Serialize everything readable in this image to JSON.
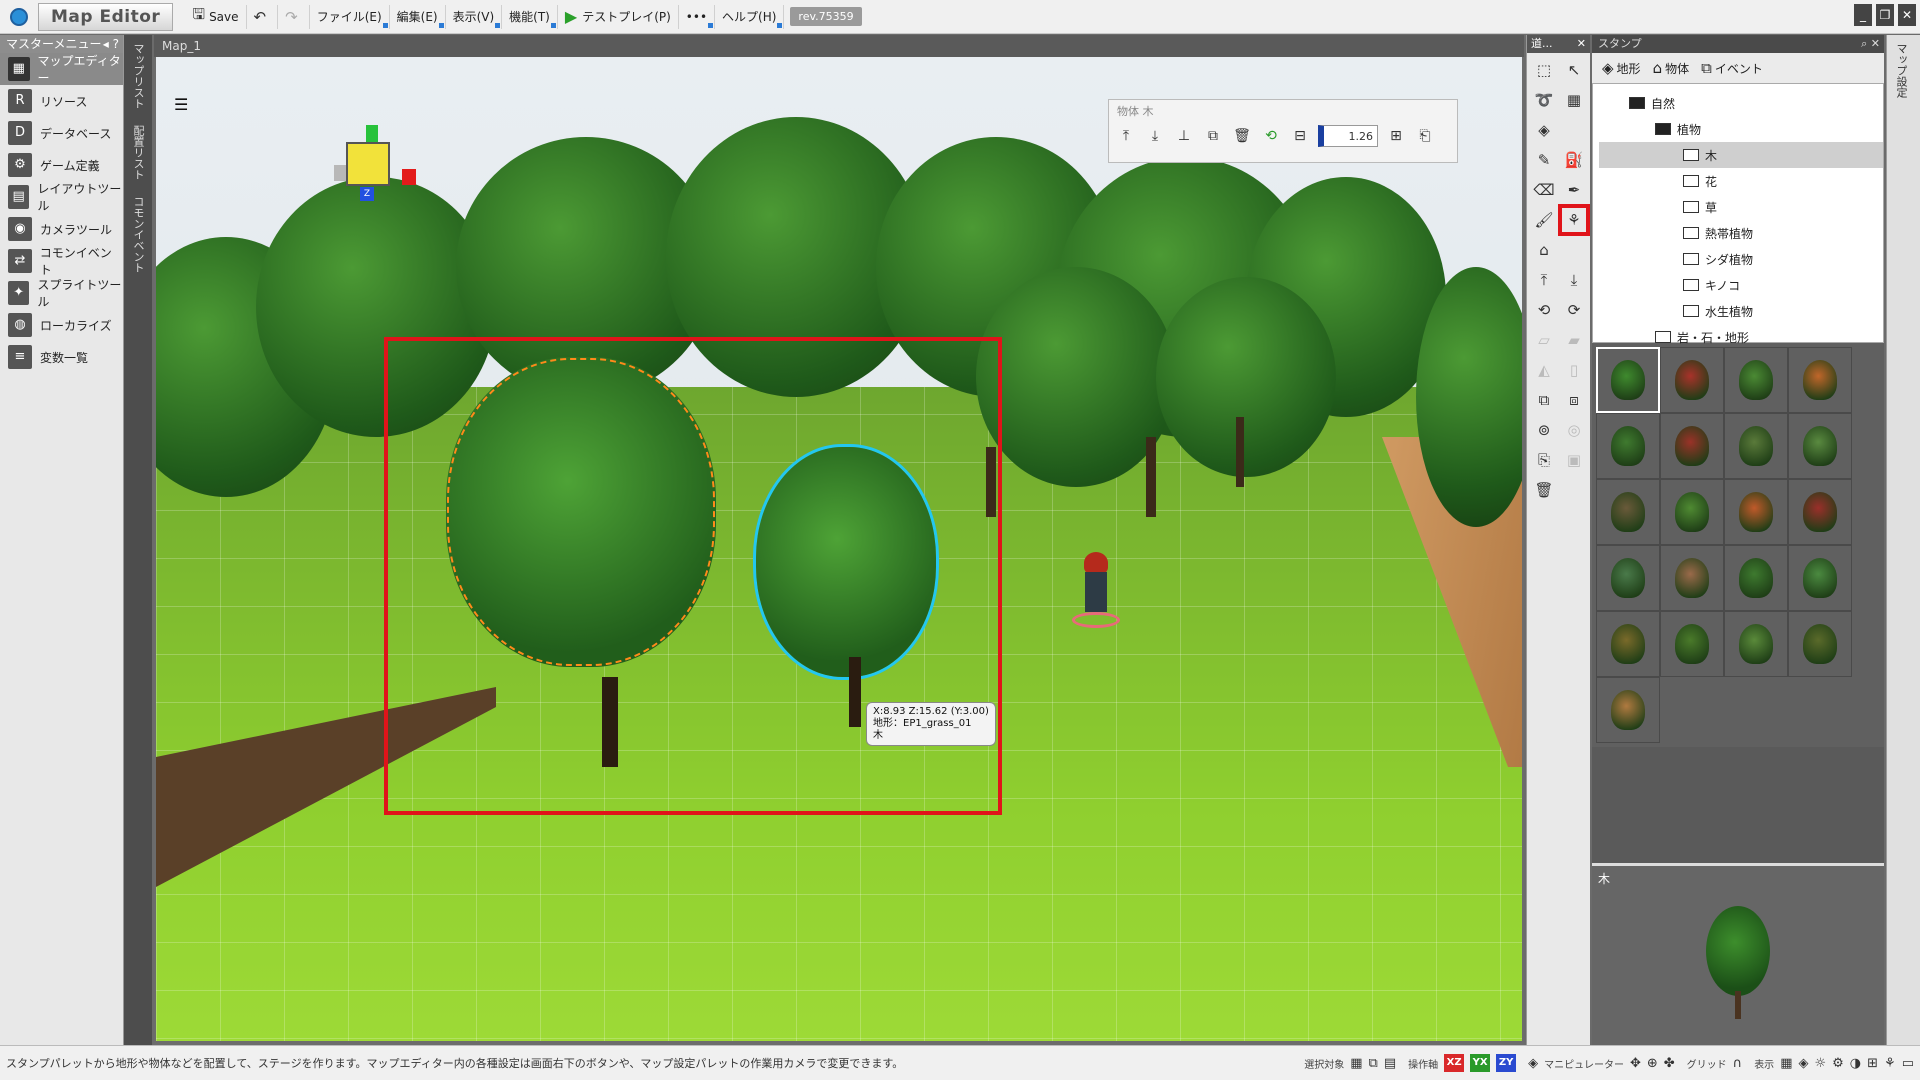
{
  "title_bar": {
    "app_title": "Map Editor",
    "save_label": "Save",
    "menus": [
      "ファイル(E)",
      "編集(E)",
      "表示(V)",
      "機能(T)"
    ],
    "test_play_label": "テストプレイ(P)",
    "more_label": "•••",
    "help_label": "ヘルプ(H)",
    "revision": "rev.75359"
  },
  "master_menu": {
    "header": "マスターメニュー",
    "items": [
      "マップエディター",
      "リソース",
      "データベース",
      "ゲーム定義",
      "レイアウトツール",
      "カメラツール",
      "コモンイベント",
      "スプライトツール",
      "ローカライズ",
      "変数一覧"
    ],
    "active_index": 0
  },
  "side_tabs": [
    "マップリスト",
    "配置リスト",
    "コモンイベント"
  ],
  "viewport": {
    "tab_label": "Map_1",
    "gizmo_axis_label": "Z",
    "object_toolbar_title": "物体 木",
    "zoom_value": "1.26",
    "position_tooltip": {
      "line1": "X:8.93 Z:15.62 (Y:3.00)",
      "line2": "地形：EP1_grass_01",
      "line3": "木"
    }
  },
  "tool_panel": {
    "header": "道..."
  },
  "stamp_panel": {
    "header": "スタンプ",
    "tabs": [
      "地形",
      "物体",
      "イベント"
    ],
    "tree": [
      {
        "label": "自然",
        "level": 0,
        "open": true
      },
      {
        "label": "植物",
        "level": 1,
        "open": true
      },
      {
        "label": "木",
        "level": 2,
        "selected": true
      },
      {
        "label": "花",
        "level": 2
      },
      {
        "label": "草",
        "level": 2
      },
      {
        "label": "熱帯植物",
        "level": 2
      },
      {
        "label": "シダ植物",
        "level": 2
      },
      {
        "label": "キノコ",
        "level": 2
      },
      {
        "label": "水生植物",
        "level": 2
      },
      {
        "label": "岩・石・地形",
        "level": 1
      }
    ],
    "thumb_colors": [
      "#3f8a2e",
      "#a8322a",
      "#4b8a34",
      "#c0662a",
      "#3f7a2f",
      "#9a3228",
      "#5a7a3a",
      "#5a8a40",
      "#6a5a3a",
      "#4f8a32",
      "#c05a2a",
      "#9a2f2a",
      "#4a7a4a",
      "#9a6a4a",
      "#3e7a2f",
      "#4b8a40",
      "#7a6a2a",
      "#4a7a2a",
      "#5a8a3a",
      "#5a6a2a",
      "#b07a40"
    ],
    "preview_label": "木"
  },
  "right_tabs": [
    "マップ設定"
  ],
  "status_bar": {
    "message": "スタンプパレットから地形や物体などを配置して、ステージを作ります。マップエディター内の各種設定は画面右下のボタンや、マップ設定パレットの作業用カメラで変更できます。",
    "select_target_label": "選択対象",
    "operation_axis_label": "操作軸",
    "axes": [
      "XZ",
      "YX",
      "ZY"
    ],
    "axis_colors": [
      "#d9282a",
      "#2a9a2a",
      "#2a4ad0"
    ],
    "manipulator_label": "マニピュレーター",
    "grid_label": "グリッド",
    "display_label": "表示"
  }
}
